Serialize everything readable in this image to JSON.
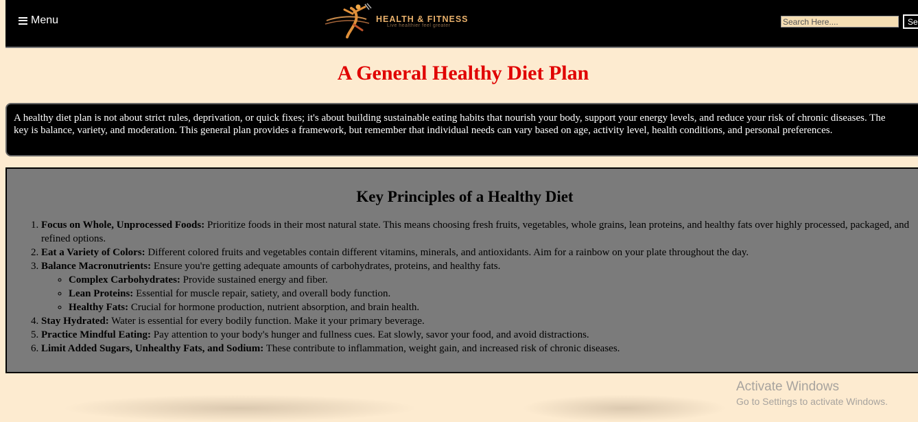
{
  "header": {
    "menu_label": "Menu",
    "logo_brand": "HEALTH & FITNESS",
    "logo_tagline": "Live healthier feel greater",
    "search_placeholder": "Search Here....",
    "search_button": "Search"
  },
  "title": "A General Healthy Diet Plan",
  "intro": "A healthy diet plan is not about strict rules, deprivation, or quick fixes; it's about building sustainable eating habits that nourish your body, support your energy levels, and reduce your risk of chronic diseases. The key is balance, variety, and moderation. This general plan provides a framework, but remember that individual needs can vary based on age, activity level, health conditions, and personal preferences.",
  "principles": {
    "heading": "Key Principles of a Healthy Diet",
    "items": [
      {
        "label": "Focus on Whole, Unprocessed Foods:",
        "text": " Prioritize foods in their most natural state. This means choosing fresh fruits, vegetables, whole grains, lean proteins, and healthy fats over highly processed, packaged, and refined options."
      },
      {
        "label": "Eat a Variety of Colors:",
        "text": " Different colored fruits and vegetables contain different vitamins, minerals, and antioxidants. Aim for a rainbow on your plate throughout the day."
      },
      {
        "label": "Balance Macronutrients:",
        "text": " Ensure you're getting adequate amounts of carbohydrates, proteins, and healthy fats.",
        "subitems": [
          {
            "label": "Complex Carbohydrates:",
            "text": " Provide sustained energy and fiber."
          },
          {
            "label": "Lean Proteins:",
            "text": " Essential for muscle repair, satiety, and overall body function."
          },
          {
            "label": "Healthy Fats:",
            "text": " Crucial for hormone production, nutrient absorption, and brain health."
          }
        ]
      },
      {
        "label": "Stay Hydrated:",
        "text": " Water is essential for every bodily function. Make it your primary beverage."
      },
      {
        "label": "Practice Mindful Eating:",
        "text": " Pay attention to your body's hunger and fullness cues. Eat slowly, savor your food, and avoid distractions."
      },
      {
        "label": "Limit Added Sugars, Unhealthy Fats, and Sodium:",
        "text": " These contribute to inflammation, weight gain, and increased risk of chronic diseases."
      }
    ]
  },
  "watermark": {
    "line1": "Activate Windows",
    "line2": "Go to Settings to activate Windows."
  },
  "colors": {
    "background": "#fdebd0",
    "header_bg": "#000000",
    "title": "#e00000",
    "principles_bg": "#7b7b7b"
  },
  "icons": [
    "hamburger-menu-icon",
    "fitness-runner-logo-icon"
  ]
}
